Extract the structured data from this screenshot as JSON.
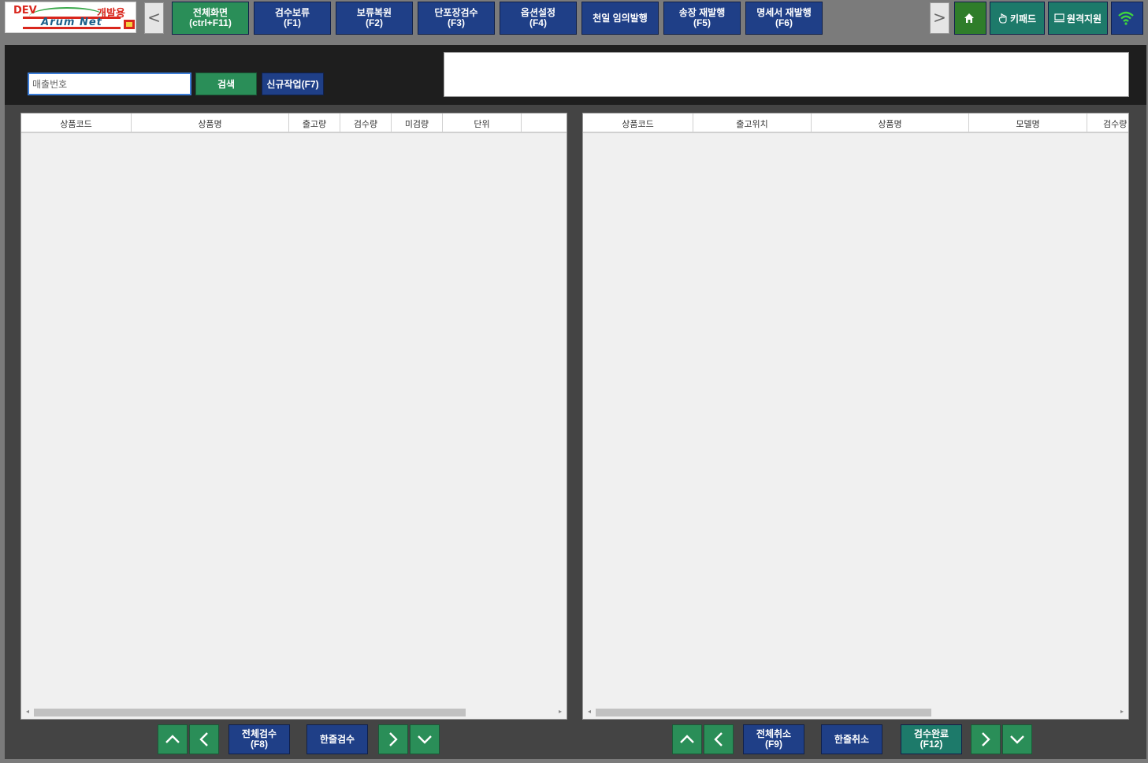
{
  "logo": {
    "dev": "DEV",
    "korean": "개발용",
    "word": "Arum Net"
  },
  "topbar": {
    "left_arrow": "<",
    "right_arrow": ">",
    "buttons": [
      {
        "label": "전체화면\n(ctrl+F11)"
      },
      {
        "label": "검수보류\n(F1)"
      },
      {
        "label": "보류복원\n(F2)"
      },
      {
        "label": "단포장검수\n(F3)"
      },
      {
        "label": "옵션설정\n(F4)"
      },
      {
        "label": "천일 임의발행"
      },
      {
        "label": "송장 재발행\n(F5)"
      },
      {
        "label": "명세서 재발행\n(F6)"
      }
    ],
    "keypad_label": "키패드",
    "remote_label": "원격지원"
  },
  "search": {
    "placeholder": "매출번호",
    "value": "",
    "search_label": "검색",
    "new_label": "신규작업(F7)"
  },
  "left_grid": {
    "columns": [
      "상품코드",
      "상품명",
      "출고량",
      "검수량",
      "미검량",
      "단위"
    ]
  },
  "right_grid": {
    "columns": [
      "상품코드",
      "출고위치",
      "상품명",
      "모델명",
      "검수량"
    ]
  },
  "actions": {
    "all_inspect": "전체검수\n(F8)",
    "one_inspect": "한줄검수",
    "all_cancel": "전체취소\n(F9)",
    "one_cancel": "한줄취소",
    "complete": "검수완료\n(F12)"
  },
  "colors": {
    "blue_button": "#1f3f87",
    "green_button": "#2a8e58",
    "teal_button": "#1d7a6a",
    "background": "#7b7b7b",
    "panel": "#444444"
  }
}
